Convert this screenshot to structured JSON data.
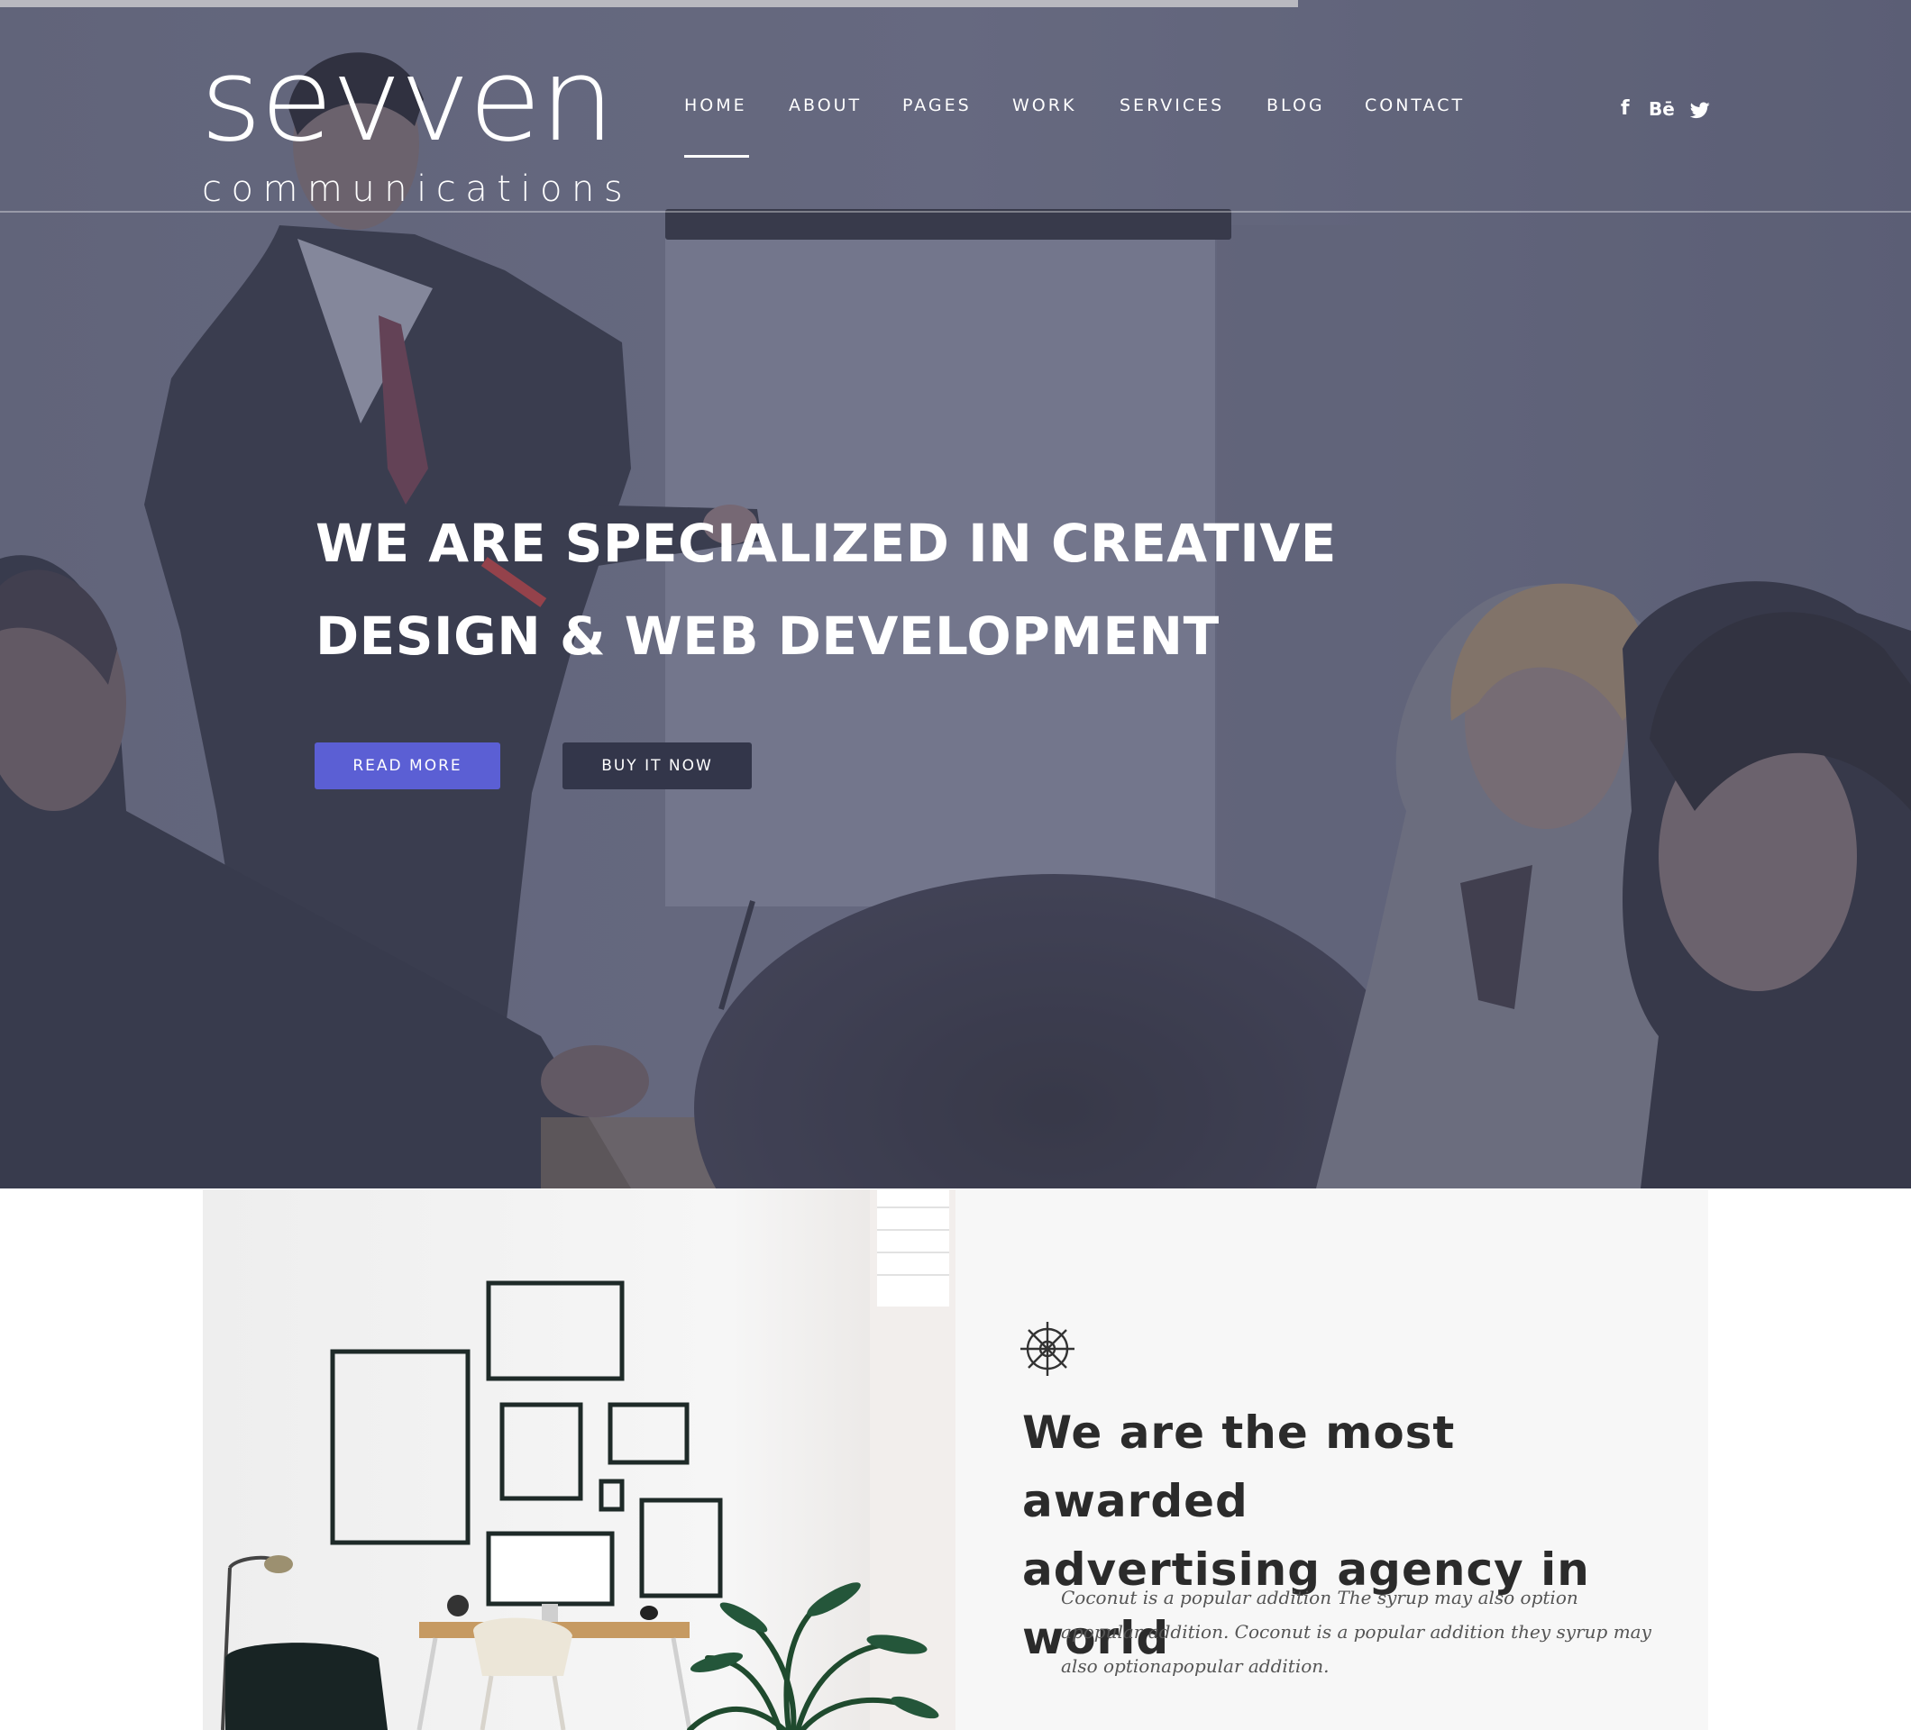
{
  "brand": {
    "logo_word": "sevven",
    "logo_sub": "communications"
  },
  "nav": {
    "items": [
      {
        "label": "HOME",
        "active": true
      },
      {
        "label": "ABOUT"
      },
      {
        "label": "PAGES"
      },
      {
        "label": "WORK"
      },
      {
        "label": "SERVICES"
      },
      {
        "label": "BLOG"
      },
      {
        "label": "CONTACT"
      }
    ]
  },
  "social": {
    "facebook": "f",
    "behance": "Bē",
    "twitter_icon": "twitter-icon"
  },
  "hero": {
    "title_line1": "WE ARE SPECIALIZED IN CREATIVE",
    "title_line2": "DESIGN & WEB DEVELOPMENT",
    "read_more": "READ MORE",
    "buy_now": "BUY IT NOW"
  },
  "about": {
    "title_line1": "We are the most awarded",
    "title_line2": "advertising agency in world",
    "text": "Coconut is a popular addition The syrup may also option apopular addition. Coconut is a popular addition they syrup may also optionapopular addition."
  },
  "colors": {
    "accent": "#5b5fd4",
    "dark_button": "#33364a",
    "hero_tint": "#5f6276",
    "panel_bg": "#f7f7f7"
  }
}
